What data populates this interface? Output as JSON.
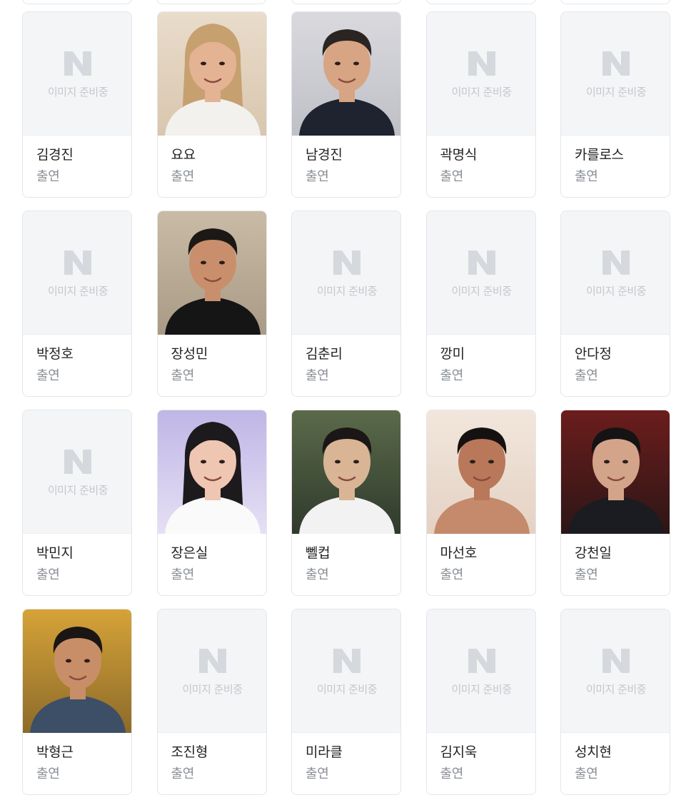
{
  "placeholder_text": "이미지 준비중",
  "placeholder_logo": "N",
  "cast": [
    {
      "name": "김경진",
      "role": "출연",
      "photo": false
    },
    {
      "name": "요요",
      "role": "출연",
      "photo": true
    },
    {
      "name": "남경진",
      "role": "출연",
      "photo": true
    },
    {
      "name": "곽명식",
      "role": "출연",
      "photo": false
    },
    {
      "name": "카를로스",
      "role": "출연",
      "photo": false
    },
    {
      "name": "박정호",
      "role": "출연",
      "photo": false
    },
    {
      "name": "장성민",
      "role": "출연",
      "photo": true
    },
    {
      "name": "김춘리",
      "role": "출연",
      "photo": false
    },
    {
      "name": "깡미",
      "role": "출연",
      "photo": false
    },
    {
      "name": "안다정",
      "role": "출연",
      "photo": false
    },
    {
      "name": "박민지",
      "role": "출연",
      "photo": false
    },
    {
      "name": "장은실",
      "role": "출연",
      "photo": true
    },
    {
      "name": "뻴컵",
      "role": "출연",
      "photo": true
    },
    {
      "name": "마선호",
      "role": "출연",
      "photo": true
    },
    {
      "name": "강천일",
      "role": "출연",
      "photo": true
    },
    {
      "name": "박형근",
      "role": "출연",
      "photo": true
    },
    {
      "name": "조진형",
      "role": "출연",
      "photo": false
    },
    {
      "name": "미라클",
      "role": "출연",
      "photo": false
    },
    {
      "name": "김지욱",
      "role": "출연",
      "photo": false
    },
    {
      "name": "성치현",
      "role": "출연",
      "photo": false
    }
  ]
}
